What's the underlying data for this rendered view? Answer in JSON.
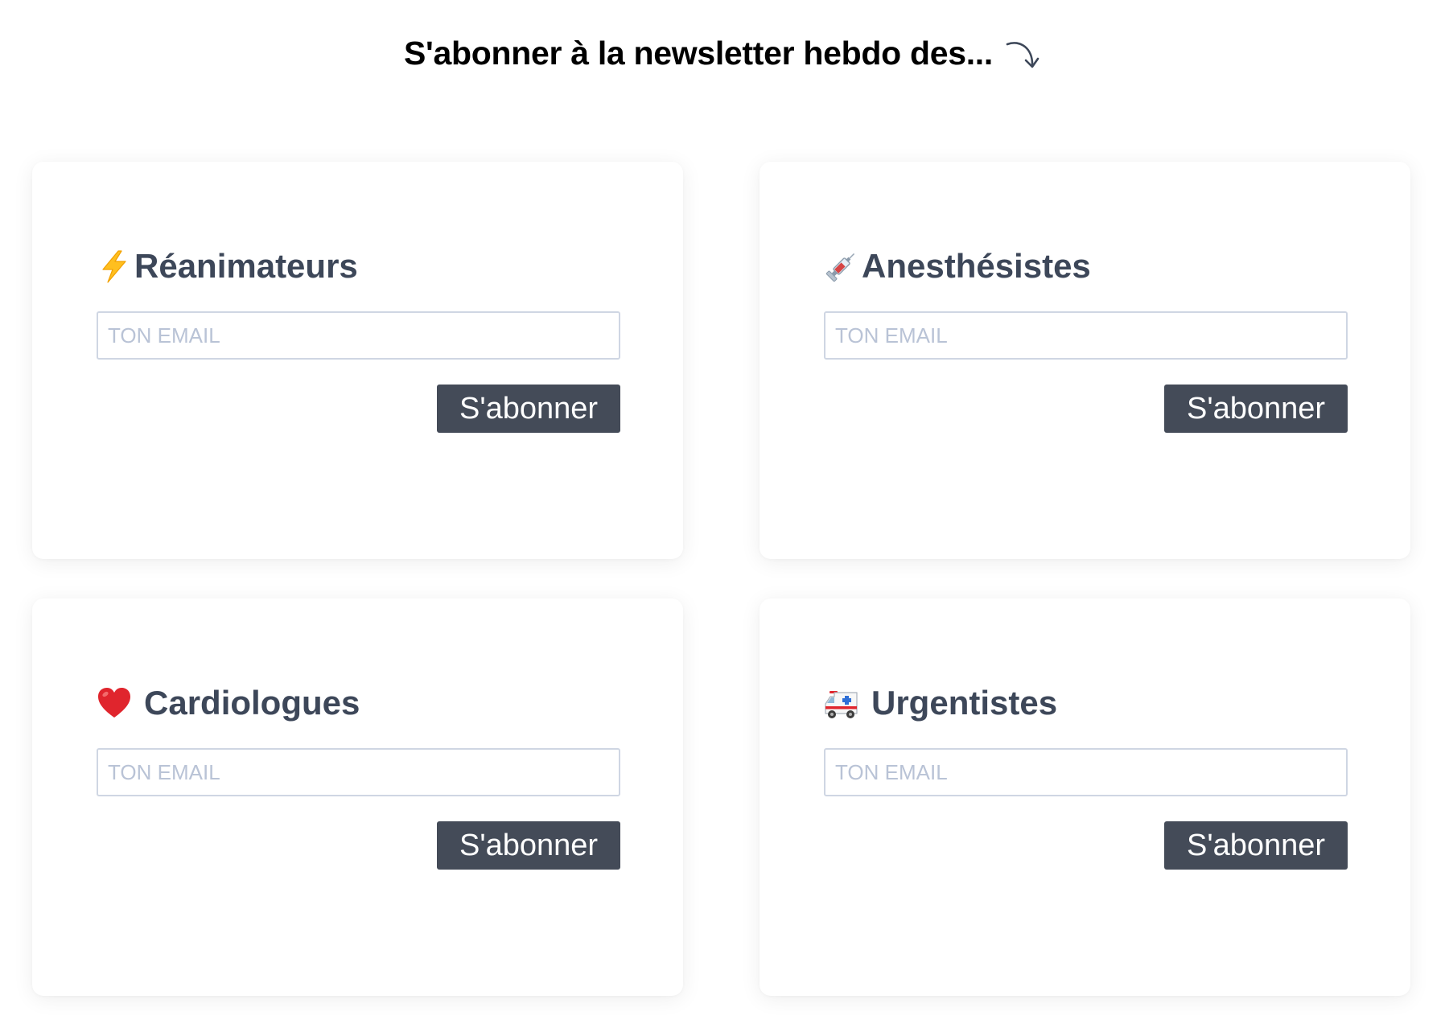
{
  "header": {
    "title": "S'abonner à la newsletter hebdo des...",
    "arrow_icon": "curved-arrow-down-right-icon"
  },
  "cards": [
    {
      "title": "Réanimateurs",
      "icon": "lightning-icon",
      "email_placeholder": "TON EMAIL",
      "email_value": "",
      "button_label": "S'abonner"
    },
    {
      "title": "Anesthésistes",
      "icon": "syringe-icon",
      "email_placeholder": "TON EMAIL",
      "email_value": "",
      "button_label": "S'abonner"
    },
    {
      "title": "Cardiologues",
      "icon": "red-heart-icon",
      "email_placeholder": "TON EMAIL",
      "email_value": "",
      "button_label": "S'abonner"
    },
    {
      "title": "Urgentistes",
      "icon": "ambulance-icon",
      "email_placeholder": "TON EMAIL",
      "email_value": "",
      "button_label": "S'abonner"
    }
  ],
  "colors": {
    "title_text": "#3d4759",
    "button_bg": "#444b58",
    "button_text": "#ffffff",
    "input_border": "#cfd6e3",
    "placeholder_text": "#b9c3d6",
    "card_bg": "#ffffff"
  }
}
